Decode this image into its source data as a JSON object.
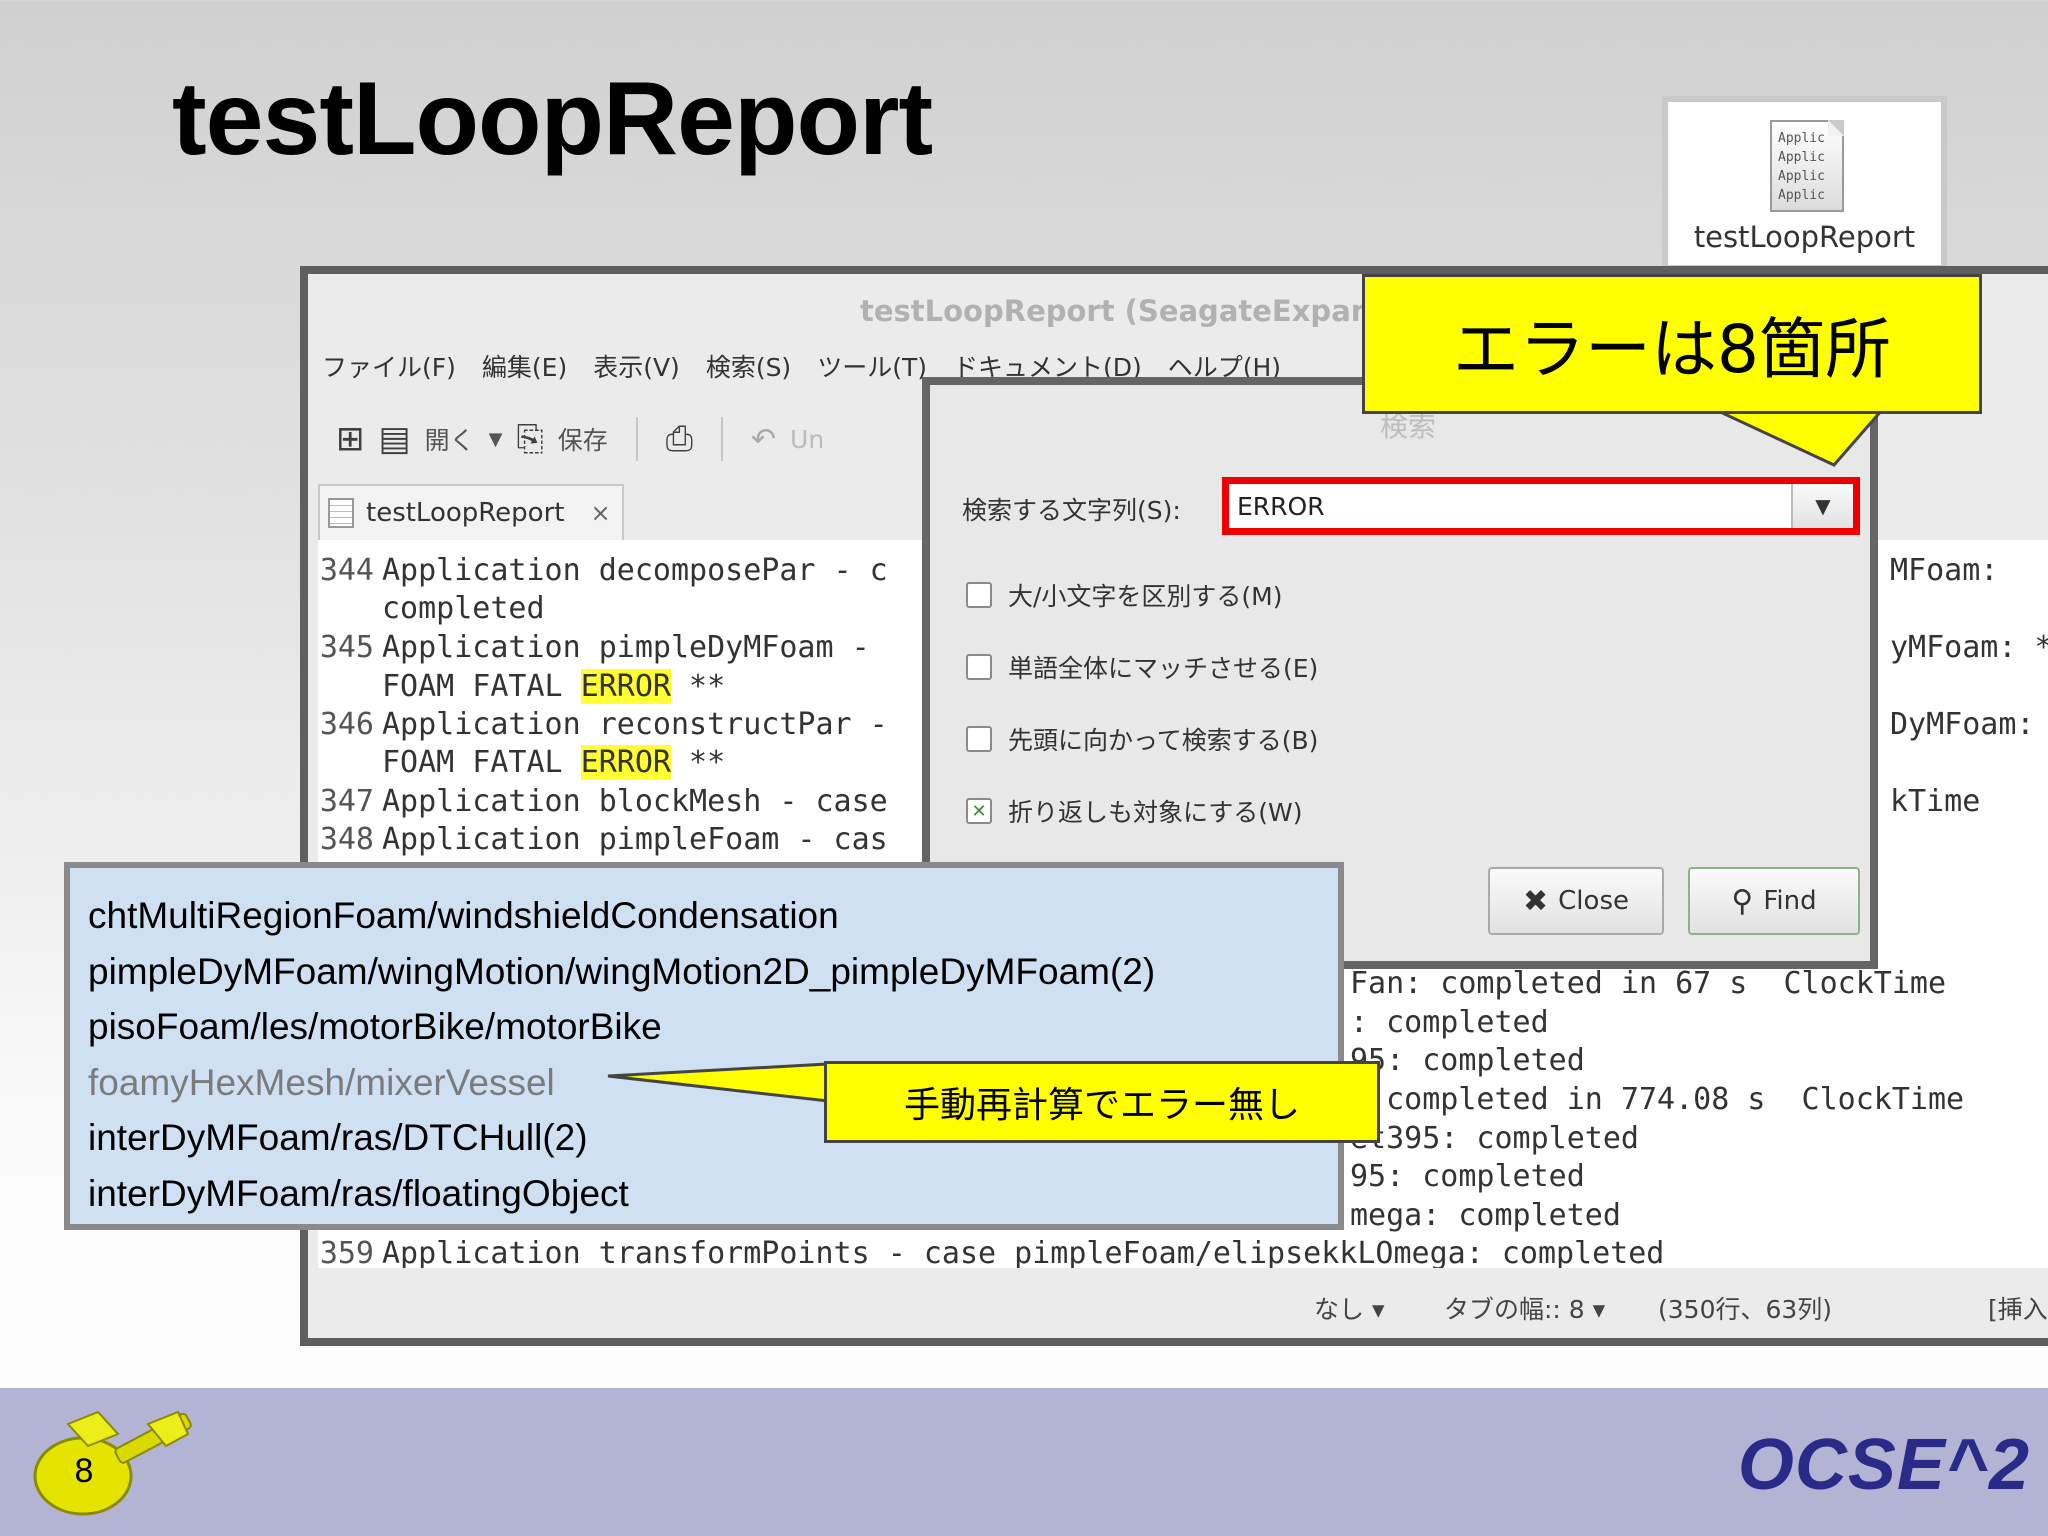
{
  "slide": {
    "title": "testLoopReport",
    "page_number": "8",
    "brand": "OCSE^2"
  },
  "desktop_icon": {
    "label": "testLoopReport",
    "icon_lines": [
      "Applic",
      "Applic",
      "Applic",
      "Applic"
    ],
    "icon": "text-file-icon"
  },
  "editor": {
    "title": "testLoopReport (SeagateExpans",
    "menu": [
      "ファイル(F)",
      "編集(E)",
      "表示(V)",
      "検索(S)",
      "ツール(T)",
      "ドキュメント(D)",
      "ヘルプ(H)"
    ],
    "toolbar": {
      "new_icon": "new-document-icon",
      "open_label": "開く",
      "save_label": "保存",
      "print_icon": "print-icon",
      "undo_label": "Un"
    },
    "tab": {
      "label": "testLoopReport",
      "close": "×"
    },
    "lines": [
      {
        "n": "344",
        "pre": "Application decomposePar - c",
        "hl": "",
        "post": ""
      },
      {
        "n": "",
        "pre": "completed",
        "hl": "",
        "post": ""
      },
      {
        "n": "345",
        "pre": "Application pimpleDyMFoam -",
        "hl": "",
        "post": ""
      },
      {
        "n": "",
        "pre": "FOAM FATAL ",
        "hl": "ERROR",
        "post": " **"
      },
      {
        "n": "346",
        "pre": "Application reconstructPar -",
        "hl": "",
        "post": ""
      },
      {
        "n": "",
        "pre": "FOAM FATAL ",
        "hl": "ERROR",
        "post": " **"
      },
      {
        "n": "347",
        "pre": "Application blockMesh - case",
        "hl": "",
        "post": ""
      },
      {
        "n": "348",
        "pre": "Application pimpleFoam - cas",
        "hl": "",
        "post": ""
      }
    ],
    "right_fragments": [
      "MFoam:",
      "yMFoam: *",
      "DyMFoam:",
      "kTime"
    ],
    "lower_fragments": [
      "Fan: completed in 67 s  ClockTime",
      ": completed",
      "95: completed",
      "  completed in 774.08 s  ClockTime",
      "et395: completed",
      "95: completed",
      "mega: completed"
    ],
    "last_line": {
      "n": "359",
      "text": "Application transformPoints - case pimpleFoam/elipsekkLOmega: completed"
    },
    "status": {
      "highlight_mode": "なし",
      "tab_width": "タブの幅:: 8",
      "position": "(350行、63列)",
      "insert_mode": "[挿入"
    }
  },
  "search_dialog": {
    "title": "検索",
    "label": "検索する文字列(S):",
    "value": "ERROR",
    "options": [
      {
        "label": "大/小文字を区別する(M)",
        "checked": false
      },
      {
        "label": "単語全体にマッチさせる(E)",
        "checked": false
      },
      {
        "label": "先頭に向かって検索する(B)",
        "checked": false
      },
      {
        "label": "折り返しも対象にする(W)",
        "checked": true
      }
    ],
    "close_label": "Close",
    "find_label": "Find"
  },
  "callout_errors": "エラーは8箇所",
  "case_list": [
    "chtMultiRegionFoam/windshieldCondensation",
    "pimpleDyMFoam/wingMotion/wingMotion2D_pimpleDyMFoam(2)",
    "pisoFoam/les/motorBike/motorBike",
    "foamyHexMesh/mixerVessel",
    "interDyMFoam/ras/DTCHull(2)",
    "interDyMFoam/ras/floatingObject"
  ],
  "callout_manual": "手動再計算でエラー無し",
  "colors": {
    "highlight": "#ffff33",
    "callout": "#ffff00",
    "search_border": "#ee0000",
    "brand": "#2a2a88",
    "case_bg": "#cfe0f3"
  }
}
